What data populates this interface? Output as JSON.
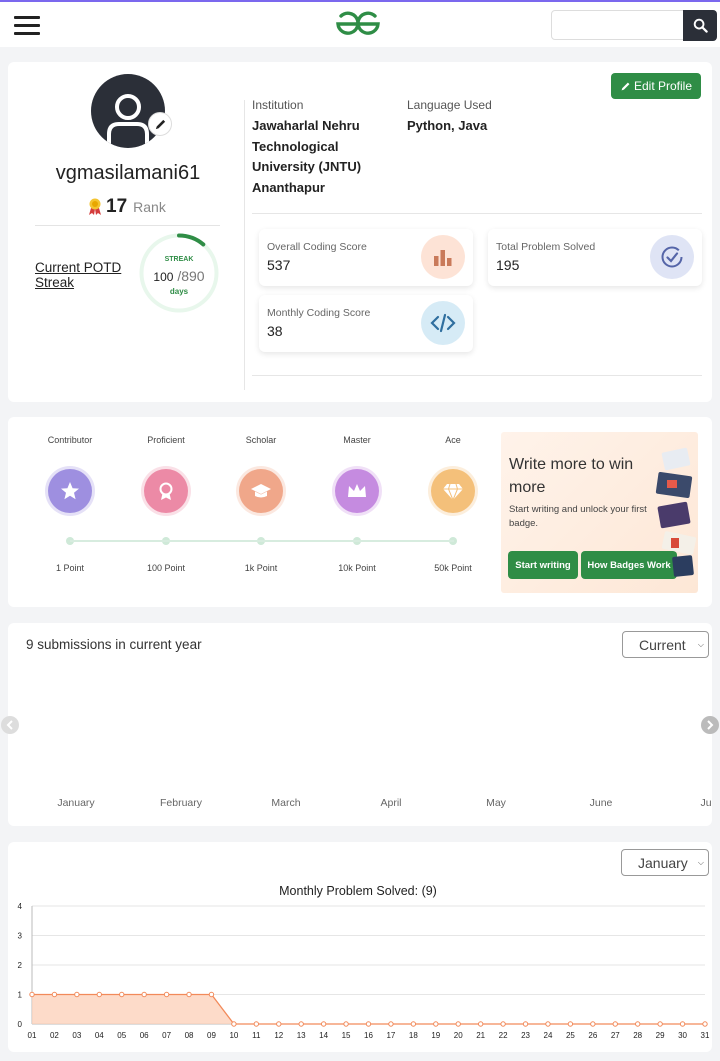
{
  "navbar": {
    "search_placeholder": ""
  },
  "profile": {
    "username": "vgmasilamani61",
    "rank_value": "17",
    "rank_label": "Rank",
    "potd_label": "Current POTD Streak",
    "streak": {
      "title": "STREAK",
      "current": "100",
      "total": "/890",
      "unit": "days",
      "fraction": 0.112
    },
    "edit_label": "Edit Profile",
    "institution_label": "Institution",
    "institution_value": "Jawaharlal Nehru Technological University (JNTU) Ananthapur",
    "language_label": "Language Used",
    "language_value": "Python, Java",
    "scores": {
      "coding_title": "Overall Coding Score",
      "coding_value": "537",
      "solved_title": "Total Problem Solved",
      "solved_value": "195",
      "monthly_title": "Monthly Coding Score",
      "monthly_value": "38"
    }
  },
  "badges": {
    "items": [
      {
        "name": "Contributor",
        "points": "1 Point",
        "icon": "star-icon",
        "color": "#9e8fe0"
      },
      {
        "name": "Proficient",
        "points": "100 Point",
        "icon": "ribbon-icon",
        "color": "#ec8aa6"
      },
      {
        "name": "Scholar",
        "points": "1k Point",
        "icon": "graduation-cap-icon",
        "color": "#f0a78a"
      },
      {
        "name": "Master",
        "points": "10k Point",
        "icon": "crown-icon",
        "color": "#c58be0"
      },
      {
        "name": "Ace",
        "points": "50k Point",
        "icon": "diamond-icon",
        "color": "#f4c07a"
      }
    ],
    "promo_title": "Write more to win more",
    "promo_text": "Start writing and unlock your first badge.",
    "start_writing": "Start writing",
    "how_badges": "How Badges Work"
  },
  "submissions": {
    "heading": "9 submissions in current year",
    "select_value": "Current",
    "months": [
      "January",
      "February",
      "March",
      "April",
      "May",
      "June",
      "Ju"
    ]
  },
  "monthly": {
    "select_value": "January",
    "accent": "#f28a5a"
  },
  "chart_data": {
    "type": "area",
    "title": "Monthly Problem Solved: (9)",
    "xlabel": "",
    "ylabel": "",
    "x": [
      "01",
      "02",
      "03",
      "04",
      "05",
      "06",
      "07",
      "08",
      "09",
      "10",
      "11",
      "12",
      "13",
      "14",
      "15",
      "16",
      "17",
      "18",
      "19",
      "20",
      "21",
      "22",
      "23",
      "24",
      "25",
      "26",
      "27",
      "28",
      "29",
      "30",
      "31"
    ],
    "values": [
      1,
      1,
      1,
      1,
      1,
      1,
      1,
      1,
      1,
      0,
      0,
      0,
      0,
      0,
      0,
      0,
      0,
      0,
      0,
      0,
      0,
      0,
      0,
      0,
      0,
      0,
      0,
      0,
      0,
      0,
      0
    ],
    "ylim": [
      0,
      4
    ],
    "yticks": [
      "0",
      "1",
      "2",
      "3",
      "4"
    ],
    "grid": true,
    "legend": "none"
  }
}
